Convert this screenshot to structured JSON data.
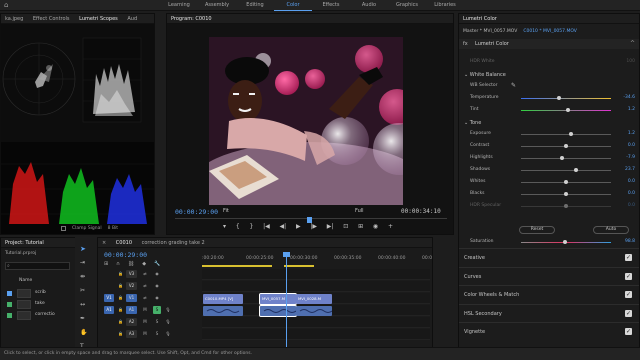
{
  "workspaces": [
    "Learning",
    "Assembly",
    "Editing",
    "Color",
    "Effects",
    "Audio",
    "Graphics",
    "Libraries"
  ],
  "active_workspace": "Color",
  "scopes_panel": {
    "tabs": [
      "ka.jpeg",
      "Effect Controls",
      "Lumetri Scopes",
      "Aud"
    ],
    "active_tab": "Lumetri Scopes",
    "clamp_label": "Clamp Signal",
    "bit_depth": "8 Bit"
  },
  "program": {
    "title": "Program: C0010",
    "timecode": "00:00:29:00",
    "fit": "Fit",
    "quality": "Full",
    "duration": "00:00:34:10"
  },
  "lumetri": {
    "title": "Lumetri Color",
    "master": "Master * MVI_0057.MOV",
    "clip": "C0010 * MVI_0057.MOV",
    "effect": "Lumetri Color",
    "hdr_white": {
      "label": "HDR White",
      "value": "100"
    },
    "white_balance": "White Balance",
    "wb_selector": "WB Selector",
    "temperature": {
      "label": "Temperature",
      "value": "-34.6",
      "level": 0.42
    },
    "tint": {
      "label": "Tint",
      "value": "1.2",
      "level": 0.52
    },
    "tone": "Tone",
    "tone_rows": [
      {
        "label": "Exposure",
        "value": "1.2",
        "level": 0.56
      },
      {
        "label": "Contrast",
        "value": "0.0",
        "level": 0.5
      },
      {
        "label": "Highlights",
        "value": "-7.9",
        "level": 0.46
      },
      {
        "label": "Shadows",
        "value": "23.7",
        "level": 0.61
      },
      {
        "label": "Whites",
        "value": "0.0",
        "level": 0.5
      },
      {
        "label": "Blacks",
        "value": "0.0",
        "level": 0.5
      },
      {
        "label": "HDR Specular",
        "value": "0.0",
        "level": 0.5
      }
    ],
    "reset_label": "Reset",
    "auto_label": "Auto",
    "saturation": {
      "label": "Saturation",
      "value": "98.8",
      "level": 0.49
    },
    "sections": [
      "Creative",
      "Curves",
      "Color Wheels & Match",
      "HSL Secondary",
      "Vignette"
    ]
  },
  "project": {
    "title": "Project: Tutorial",
    "file": "Tutorial.prproj",
    "name_header": "Name",
    "items": [
      {
        "label": "scrib",
        "color": "#5aa0f0"
      },
      {
        "label": "take",
        "color": "#46b06a"
      },
      {
        "label": "correctio",
        "color": "#46b06a"
      }
    ]
  },
  "timeline": {
    "tabs": [
      "C0010",
      "correction grading take 2"
    ],
    "timecode": "00:00:29:00",
    "ruler": [
      ":00:20:00",
      "00:00:25:00",
      "00:00:30:00",
      "00:00:35:00",
      "00:00:40:00",
      "00:00"
    ],
    "tracks": {
      "video": [
        "V3",
        "V2",
        "V1"
      ],
      "audio": [
        "A1",
        "A2",
        "A3"
      ],
      "src_v": "V1",
      "src_a": "A1"
    },
    "clips": [
      {
        "label": "C0010.MP4 [V]",
        "track": "V1",
        "color": "#6f82c9"
      },
      {
        "label": "MVI_0057.M",
        "track": "V1",
        "color": "#6f82c9"
      },
      {
        "label": "MVI_0028.M",
        "track": "V1",
        "color": "#6f82c9"
      }
    ]
  },
  "status_text": "Click to select, or click in empty space and drag to marquee select. Use Shift, Opt, and Cmd for other options.",
  "colors": {
    "accent": "#5aa0f0",
    "clip_video": "#6f82c9",
    "clip_audio": "#4f6fb0",
    "source_patch": "#46b06a"
  }
}
